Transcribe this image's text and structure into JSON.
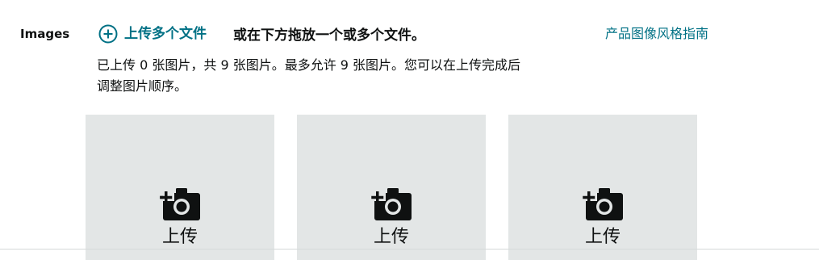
{
  "section": {
    "label": "Images"
  },
  "upload": {
    "link_label": "上传多个文件",
    "drop_hint": "或在下方拖放一个或多个文件。",
    "icon": "plus-circle-icon"
  },
  "guide_link": "产品图像风格指南",
  "info": {
    "line1": "已上传 0 张图片，共 9 张图片。最多允许 9 张图片。您可以在上传完成后",
    "line2": "调整图片顺序。"
  },
  "tiles": [
    {
      "label": "上传",
      "icon": "add-photo-camera-icon"
    },
    {
      "label": "上传",
      "icon": "add-photo-camera-icon"
    },
    {
      "label": "上传",
      "icon": "add-photo-camera-icon"
    }
  ],
  "colors": {
    "link": "#007185",
    "text": "#0f1111",
    "tile_bg": "#e3e6e6"
  }
}
